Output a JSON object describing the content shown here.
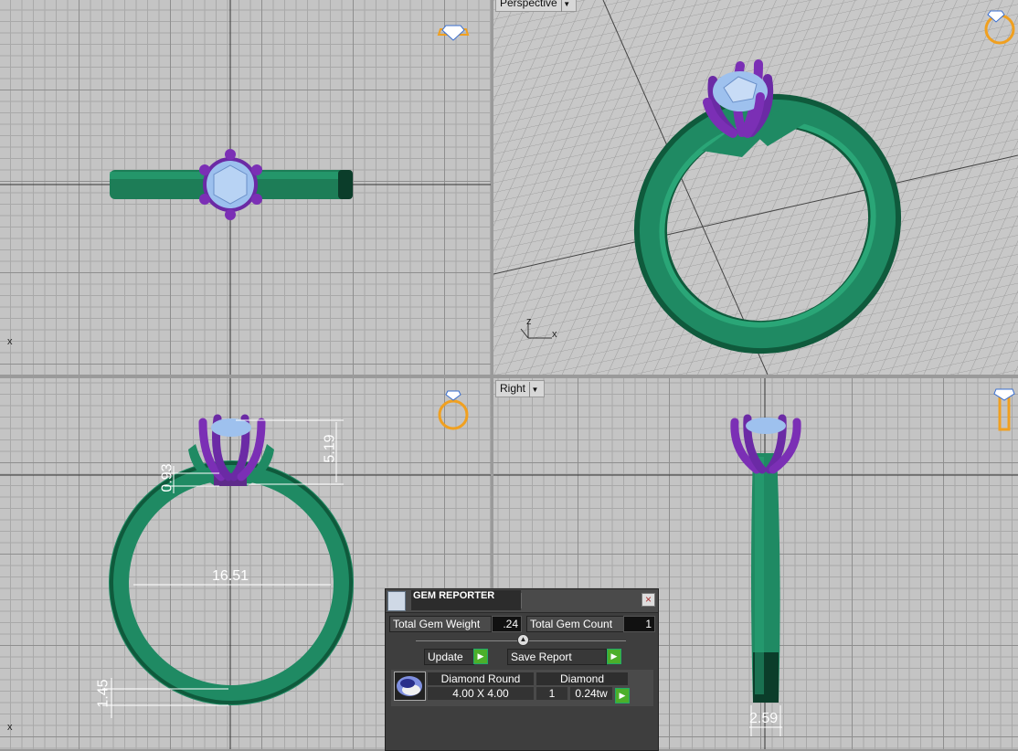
{
  "viewports": {
    "top": {
      "axis_label": "x"
    },
    "perspective": {
      "label": "Perspective",
      "axis_z": "z",
      "axis_x": "x"
    },
    "front": {
      "axis_label": "x"
    },
    "right": {
      "label": "Right"
    }
  },
  "dimensions": {
    "height_stone": "5.19",
    "seat_height": "0.93",
    "inner_diameter": "16.51",
    "band_thickness": "1.45",
    "band_width": "2.59"
  },
  "gem_reporter": {
    "title": "GEM REPORTER",
    "total_gem_weight_label": "Total Gem Weight",
    "total_gem_weight": ".24",
    "total_gem_count_label": "Total Gem Count",
    "total_gem_count": "1",
    "update_label": "Update",
    "save_report_label": "Save Report",
    "table": {
      "headers": [
        "Diamond Round",
        "Diamond"
      ],
      "size": "4.00 X 4.00",
      "count": "1",
      "weight": "0.24tw"
    }
  },
  "colors": {
    "band": "#1f8a63",
    "prongs": "#7b2fb5",
    "stone": "#9ec1ee",
    "nav_icon": "#f0a020"
  },
  "icons": {
    "view_cube": "ring-icon",
    "close": "close-icon",
    "play": "play-icon"
  }
}
